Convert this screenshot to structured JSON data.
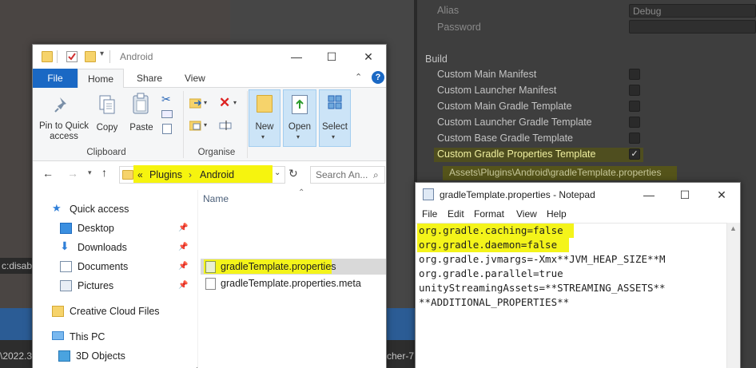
{
  "unity": {
    "fragments": {
      "console": "c:disab",
      "path": "\\2022.3",
      "launcher": "cher-7"
    },
    "inspector": {
      "alias_label": "Alias",
      "alias_value": "Debug",
      "password_label": "Password",
      "build_header": "Build",
      "options": [
        {
          "label": "Custom Main Manifest",
          "checked": false
        },
        {
          "label": "Custom Launcher Manifest",
          "checked": false
        },
        {
          "label": "Custom Main Gradle Template",
          "checked": false
        },
        {
          "label": "Custom Launcher Gradle Template",
          "checked": false
        },
        {
          "label": "Custom Base Gradle Template",
          "checked": false
        },
        {
          "label": "Custom Gradle Properties Template",
          "checked": true
        }
      ],
      "check_glyph": "✓",
      "assets_path": "Assets\\Plugins\\Android\\gradleTemplate.properties"
    }
  },
  "explorer": {
    "title": "Android",
    "window": {
      "minimize": "—",
      "maximize": "☐",
      "close": "✕"
    },
    "tabs": {
      "file": "File",
      "home": "Home",
      "share": "Share",
      "view": "View"
    },
    "ribbon": {
      "pin": "Pin to Quick access",
      "copy": "Copy",
      "paste": "Paste",
      "clipboard": "Clipboard",
      "organise": "Organise",
      "new": "New",
      "open": "Open",
      "select": "Select"
    },
    "address": {
      "chevron": "«",
      "segments": [
        "Plugins",
        "Android"
      ],
      "separator": "›"
    },
    "search_placeholder": "Search An...",
    "column_name": "Name",
    "nav": [
      {
        "label": "Quick access",
        "icon": "star-icon",
        "pinned": false
      },
      {
        "label": "Desktop",
        "icon": "desktop-icon",
        "pinned": true
      },
      {
        "label": "Downloads",
        "icon": "download-icon",
        "pinned": true
      },
      {
        "label": "Documents",
        "icon": "documents-icon",
        "pinned": true
      },
      {
        "label": "Pictures",
        "icon": "pictures-icon",
        "pinned": true
      },
      {
        "label": "Creative Cloud Files",
        "icon": "creative-cloud-icon",
        "pinned": false
      },
      {
        "label": "This PC",
        "icon": "pc-icon",
        "pinned": false
      },
      {
        "label": "3D Objects",
        "icon": "cube-icon",
        "pinned": false
      }
    ],
    "files": [
      {
        "name": "gradleTemplate.properties",
        "selected": true
      },
      {
        "name": "gradleTemplate.properties.meta",
        "selected": false
      }
    ]
  },
  "notepad": {
    "title": "gradleTemplate.properties - Notepad",
    "window": {
      "minimize": "—",
      "maximize": "☐",
      "close": "✕"
    },
    "menu": [
      "File",
      "Edit",
      "Format",
      "View",
      "Help"
    ],
    "lines": [
      "org.gradle.caching=false",
      "org.gradle.daemon=false",
      "org.gradle.jvmargs=-Xmx**JVM_HEAP_SIZE**M",
      "org.gradle.parallel=true",
      "unityStreamingAssets=**STREAMING_ASSETS**",
      "**ADDITIONAL_PROPERTIES**"
    ]
  },
  "colors": {
    "highlight": "#f4f41a",
    "file_tab": "#1a68c4",
    "unity_bar": "#2b5c95"
  }
}
